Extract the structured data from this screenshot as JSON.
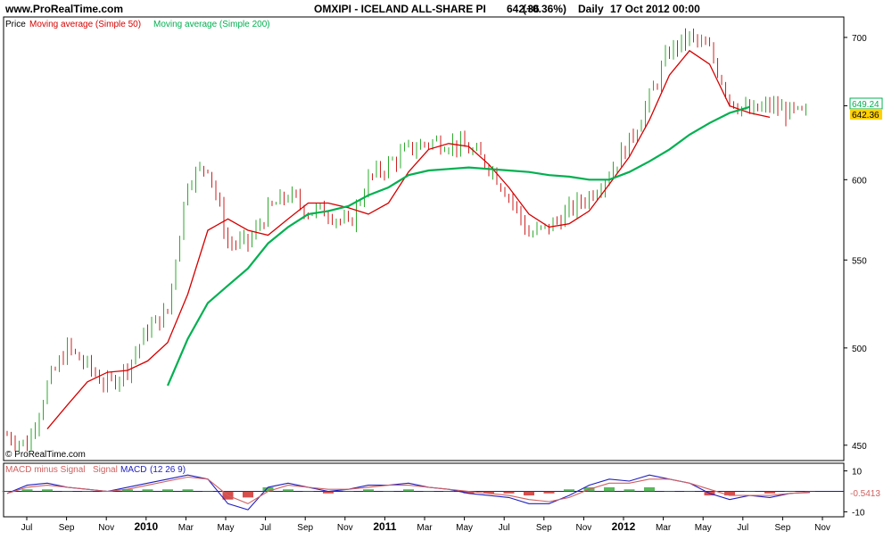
{
  "header": {
    "site": "www.ProRealTime.com",
    "instrument": "OMXIPI - ICELAND ALL-SHARE PI",
    "price": "642.36",
    "change": "(+0.36%)",
    "period": "Daily",
    "datetime": "17 Oct 2012 00:00"
  },
  "main_panel": {
    "legend": [
      {
        "label": "Price",
        "color": "#000000"
      },
      {
        "label": "Moving average (Simple 50)",
        "color": "#d60000"
      },
      {
        "label": "Moving average (Simple 200)",
        "color": "#00b050"
      }
    ],
    "watermark": "© ProRealTime.com",
    "price_tag": "642.36",
    "ma200_tag": "649.24"
  },
  "macd_panel": {
    "legend": [
      {
        "label": "MACD minus Signal",
        "color": "#d06060"
      },
      {
        "label": "Signal",
        "color": "#d06060"
      },
      {
        "label": "MACD",
        "color": "#2020c0"
      },
      {
        "label": "(12 26 9)",
        "color": "#2020c0"
      }
    ],
    "value_tag": "-0.5413"
  },
  "colors": {
    "up_bar": "#2fa82f",
    "down_bar": "#cc2222",
    "ma50": "#d60000",
    "ma200": "#00b050",
    "macd": "#2020c0",
    "signal": "#d06060",
    "zero_line": "#1a1aa0",
    "price_tag_bg": "#ffd000"
  },
  "chart_data": [
    {
      "type": "line",
      "title": "OMXIPI - ICELAND ALL-SHARE PI",
      "scale": "log",
      "ylim": [
        443,
        715
      ],
      "x_ticks": [
        "Jul",
        "Sep",
        "Nov",
        "2010",
        "Mar",
        "May",
        "Jul",
        "Sep",
        "Nov",
        "2011",
        "Mar",
        "May",
        "Jul",
        "Sep",
        "Nov",
        "2012",
        "Mar",
        "May",
        "Jul",
        "Sep",
        "Nov"
      ],
      "y_ticks": [
        450,
        500,
        550,
        600,
        650,
        700
      ],
      "x": [
        "2009-06",
        "2009-07",
        "2009-08",
        "2009-09",
        "2009-10",
        "2009-11",
        "2009-12",
        "2010-01",
        "2010-02",
        "2010-03",
        "2010-04",
        "2010-05",
        "2010-06",
        "2010-07",
        "2010-08",
        "2010-09",
        "2010-10",
        "2010-11",
        "2010-12",
        "2011-01",
        "2011-02",
        "2011-03",
        "2011-04",
        "2011-05",
        "2011-06",
        "2011-07",
        "2011-08",
        "2011-09",
        "2011-10",
        "2011-11",
        "2011-12",
        "2012-01",
        "2012-02",
        "2012-03",
        "2012-04",
        "2012-05",
        "2012-06",
        "2012-07",
        "2012-08",
        "2012-09",
        "2012-10"
      ],
      "series": [
        {
          "name": "Price",
          "values": [
            455,
            450,
            480,
            500,
            490,
            480,
            490,
            510,
            520,
            600,
            610,
            560,
            560,
            580,
            590,
            580,
            580,
            570,
            600,
            610,
            620,
            625,
            625,
            620,
            610,
            590,
            565,
            570,
            580,
            590,
            605,
            625,
            655,
            690,
            700,
            690,
            655,
            645,
            650,
            645,
            642.36
          ]
        },
        {
          "name": "Moving average (Simple 50)",
          "values": [
            null,
            null,
            458,
            470,
            482,
            487,
            488,
            493,
            503,
            530,
            568,
            575,
            568,
            565,
            575,
            585,
            585,
            582,
            578,
            585,
            605,
            620,
            624,
            622,
            610,
            595,
            578,
            570,
            572,
            580,
            597,
            615,
            640,
            672,
            690,
            680,
            650,
            645,
            642,
            null,
            null
          ]
        },
        {
          "name": "Moving average (Simple 200)",
          "values": [
            null,
            null,
            null,
            null,
            null,
            null,
            null,
            null,
            480,
            505,
            525,
            535,
            545,
            560,
            570,
            578,
            580,
            583,
            590,
            595,
            603,
            606,
            607,
            608,
            607,
            606,
            605,
            603,
            602,
            600,
            600,
            605,
            612,
            620,
            630,
            638,
            645,
            649.24,
            null,
            null,
            null
          ]
        }
      ]
    },
    {
      "type": "line",
      "title": "MACD (12 26 9)",
      "ylim": [
        -12,
        12
      ],
      "y_ticks": [
        10,
        -10
      ],
      "series": [
        {
          "name": "MACD",
          "values": [
            -1,
            3,
            4,
            2,
            1,
            0,
            2,
            4,
            6,
            8,
            6,
            -6,
            -9,
            2,
            4,
            2,
            0,
            1,
            3,
            3,
            4,
            2,
            1,
            -1,
            -2,
            -3,
            -6,
            -6,
            -2,
            3,
            6,
            5,
            8,
            6,
            4,
            -1,
            -4,
            -2,
            -3,
            -1,
            -0.5413
          ]
        },
        {
          "name": "Signal",
          "values": [
            -1,
            2,
            3,
            2,
            1,
            0,
            1,
            3,
            5,
            7,
            6,
            -2,
            -6,
            0,
            3,
            2,
            1,
            1,
            2,
            3,
            3,
            2,
            1,
            0,
            -1,
            -2,
            -4,
            -5,
            -3,
            1,
            4,
            4,
            6,
            6,
            4,
            1,
            -2,
            -2,
            -2,
            -1,
            -0.3
          ]
        },
        {
          "name": "MACD minus Signal",
          "values": [
            0,
            1,
            1,
            0,
            0,
            0,
            1,
            1,
            1,
            1,
            0,
            -4,
            -3,
            2,
            1,
            0,
            -1,
            0,
            1,
            0,
            1,
            0,
            0,
            -1,
            -1,
            -1,
            -2,
            -1,
            1,
            2,
            2,
            1,
            2,
            0,
            0,
            -2,
            -2,
            0,
            -1,
            0,
            -0.2
          ]
        }
      ]
    }
  ]
}
